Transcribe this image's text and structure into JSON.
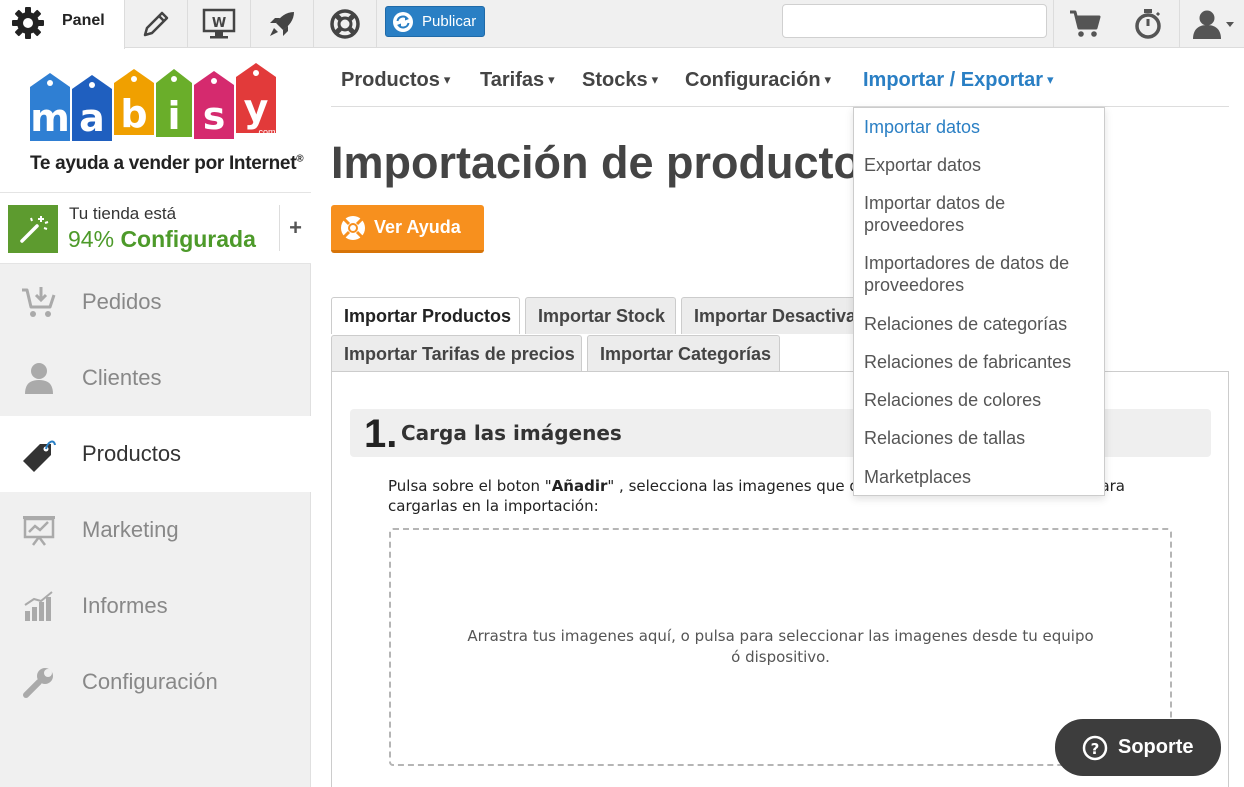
{
  "topbar": {
    "panel_label": "Panel",
    "publish_label": "Publicar",
    "search": {
      "value": "",
      "placeholder": ""
    },
    "icons": [
      "gear-icon",
      "pencil-icon",
      "web-icon",
      "rocket-icon",
      "lifebuoy-icon",
      "refresh-icon",
      "cart-icon",
      "stopwatch-icon",
      "user-icon"
    ]
  },
  "sidebar": {
    "logo_text": "mabisy",
    "logo_com": ".com",
    "tagline": "Te ayuda a vender por Internet",
    "tagline_mark": "®",
    "config": {
      "line1": "Tu tienda está",
      "percent": "94%",
      "status": "Configurada",
      "plus": "+"
    },
    "items": [
      {
        "label": "Pedidos",
        "icon": "cart-download-icon",
        "active": false
      },
      {
        "label": "Clientes",
        "icon": "user-icon",
        "active": false
      },
      {
        "label": "Productos",
        "icon": "tag-icon",
        "active": true
      },
      {
        "label": "Marketing",
        "icon": "presentation-chart-icon",
        "active": false
      },
      {
        "label": "Informes",
        "icon": "bar-chart-icon",
        "active": false
      },
      {
        "label": "Configuración",
        "icon": "wrench-icon",
        "active": false
      }
    ]
  },
  "menu": {
    "items": [
      {
        "label": "Productos",
        "caret": "▾"
      },
      {
        "label": "Tarifas",
        "caret": "▾"
      },
      {
        "label": "Stocks",
        "caret": "▾"
      },
      {
        "label": "Configuración",
        "caret": "▾"
      },
      {
        "label": "Importar / Exportar",
        "caret": "▾"
      }
    ]
  },
  "dropdown": {
    "items": [
      "Importar datos",
      "Exportar datos",
      "Importar datos de proveedores",
      "Importadores de datos de proveedores",
      "Relaciones de categorías",
      "Relaciones de fabricantes",
      "Relaciones de colores",
      "Relaciones de tallas",
      "Marketplaces"
    ]
  },
  "main": {
    "title": "Importación de productos",
    "help_label": "Ver Ayuda",
    "tabs": [
      "Importar Productos",
      "Importar Stock",
      "Importar Desactivar",
      "Importar Tarifas de precios",
      "Importar Categorías"
    ],
    "step": {
      "number": "1.",
      "title": "Carga las imágenes",
      "desc_before": "Pulsa sobre el boton \"",
      "desc_bold": "Añadir",
      "desc_after": "\" , selecciona las imagenes que quieres subir y pulsa en \"Subir\" para cargarlas en la importación:",
      "dropzone_text": "Arrastra tus imagenes aquí, o pulsa para seleccionar las imagenes desde tu equipo ó dispositivo."
    }
  },
  "support_label": "Soporte",
  "colors": {
    "accent_blue": "#2a7fc4",
    "orange": "#f7901e",
    "green": "#4d9a2a",
    "dark": "#3d3d3d"
  }
}
